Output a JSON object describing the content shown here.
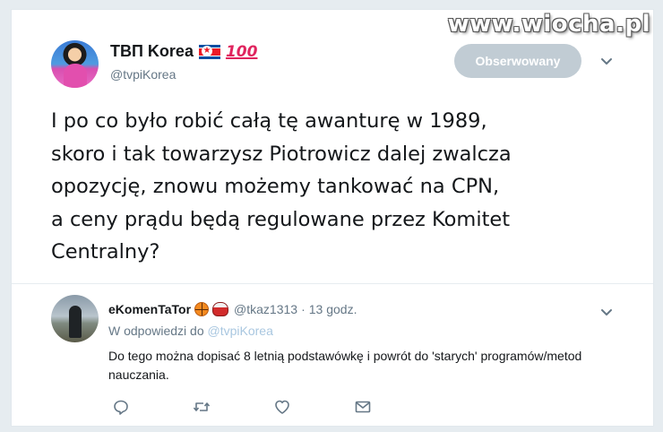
{
  "watermark": "www.wiocha.pl",
  "tweet": {
    "display_name": "ТВП Korea",
    "hundred_emoji": "100",
    "handle": "@tvpiKorea",
    "follow_label": "Obserwowany",
    "text": "I po co było robić całą tę awanturę w 1989,\nskoro i tak towarzysz Piotrowicz dalej zwalcza\nopozycję, znowu możemy tankować na CPN,\na ceny prądu będą regulowane przez Komitet\nCentralny?"
  },
  "reply": {
    "display_name": "eKomenTaTor",
    "handle": "@tkaz1313",
    "separator": "·",
    "time": "13 godz.",
    "in_reply_prefix": "W odpowiedzi do",
    "in_reply_handle": "@tvpiKorea",
    "text": "Do tego można dopisać 8 letnią podstawówkę i powrót do 'starych' programów/metod nauczania."
  },
  "icons": {
    "flag": "north-korea-flag-icon",
    "hundred": "hundred-points-icon",
    "chevron": "chevron-down-icon",
    "basketball": "basketball-icon",
    "drum": "drum-icon",
    "reply": "reply-icon",
    "retweet": "retweet-icon",
    "like": "heart-icon",
    "message": "envelope-icon"
  },
  "colors": {
    "follow_button_bg": "#c1ccd4",
    "secondary_text": "#657786",
    "link_text": "#a9c7e0",
    "primary_text": "#14171a"
  }
}
